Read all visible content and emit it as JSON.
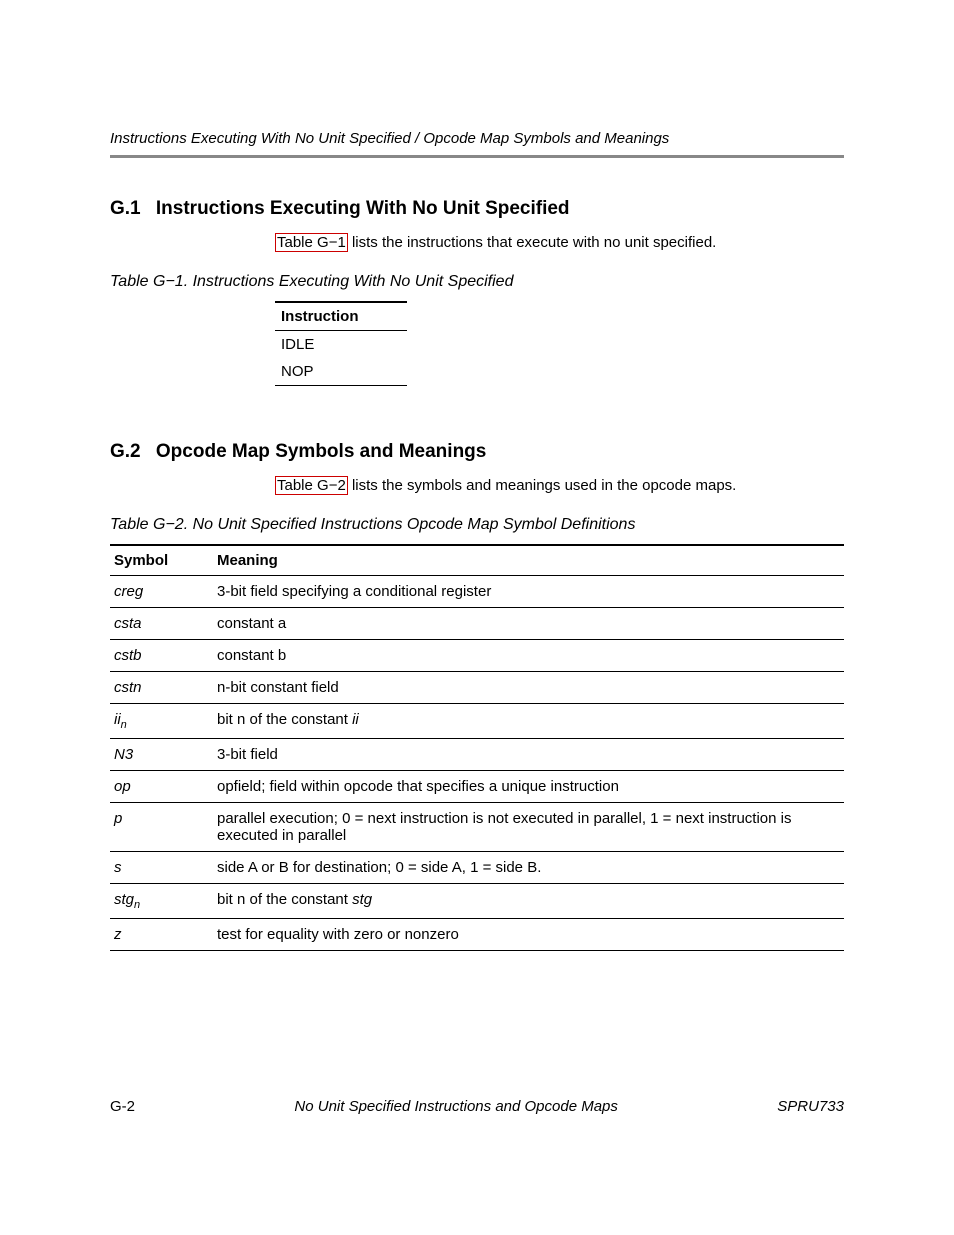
{
  "running_head": "Instructions Executing With No Unit Specified / Opcode Map Symbols and Meanings",
  "section1": {
    "num": "G.1",
    "title": "Instructions Executing With No Unit Specified",
    "ref": "Table G−1",
    "text_tail": " lists the instructions that execute with no unit specified.",
    "caption": "Table G−1. Instructions Executing With No Unit Specified",
    "col": "Instruction",
    "rows": [
      "IDLE",
      "NOP"
    ]
  },
  "section2": {
    "num": "G.2",
    "title": "Opcode Map Symbols and Meanings",
    "ref": "Table G−2",
    "text_tail": " lists the symbols and meanings used in the opcode maps.",
    "caption": "Table G−2. No Unit Specified Instructions Opcode Map Symbol Definitions",
    "col1": "Symbol",
    "col2": "Meaning",
    "rows": [
      {
        "sym_html": "creg",
        "mean_html": "3-bit field specifying a conditional register"
      },
      {
        "sym_html": "csta",
        "mean_html": "constant a"
      },
      {
        "sym_html": "cstb",
        "mean_html": "constant b"
      },
      {
        "sym_html": "cstn",
        "mean_html": "n-bit constant field"
      },
      {
        "sym_html": "ii<span class=\"sub\">n</span>",
        "mean_html": "bit n of the constant <span class=\"it\">ii</span>"
      },
      {
        "sym_html": "N3",
        "mean_html": "3-bit field"
      },
      {
        "sym_html": "op",
        "mean_html": "opfield; field within opcode that specifies a unique instruction"
      },
      {
        "sym_html": "p",
        "mean_html": "parallel execution; 0 = next instruction is not executed in parallel, 1 = next instruction is executed in parallel"
      },
      {
        "sym_html": "s",
        "mean_html": "side A or B for destination; 0 = side A, 1 = side B."
      },
      {
        "sym_html": "stg<span class=\"sub\">n</span>",
        "mean_html": "bit n of the constant <span class=\"it\">stg</span>"
      },
      {
        "sym_html": "z",
        "mean_html": "test for equality with zero or nonzero"
      }
    ]
  },
  "footer": {
    "page": "G-2",
    "center": "No Unit Specified Instructions and Opcode Maps",
    "doc": "SPRU733"
  }
}
